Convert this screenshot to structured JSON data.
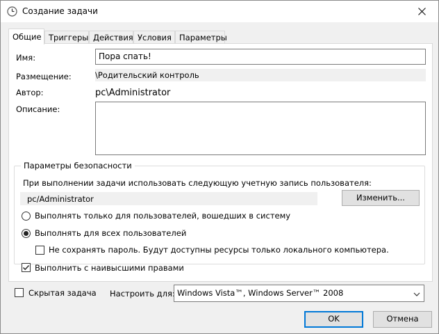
{
  "window": {
    "title": "Создание задачи"
  },
  "tabs": [
    {
      "label": "Общие"
    },
    {
      "label": "Триггеры"
    },
    {
      "label": "Действия"
    },
    {
      "label": "Условия"
    },
    {
      "label": "Параметры"
    }
  ],
  "general": {
    "name_label": "Имя:",
    "name_value": "Пора спать!",
    "location_label": "Размещение:",
    "location_value": "\\Родительский контроль",
    "author_label": "Автор:",
    "author_value": "pc\\Administrator",
    "description_label": "Описание:",
    "description_value": ""
  },
  "security": {
    "group_title": "Параметры безопасности",
    "account_prompt": "При выполнении задачи использовать следующую учетную запись пользователя:",
    "account_value": "pc/Administrator",
    "change_button": "Изменить...",
    "radio_logged_on": "Выполнять только для пользователей, вошедших в систему",
    "radio_all_users": "Выполнять для всех пользователей",
    "selected_radio": "all_users",
    "no_store_password": "Не сохранять пароль. Будут доступны ресурсы только локального компьютера.",
    "no_store_password_checked": false,
    "highest_privileges": "Выполнить с наивысшими правами",
    "highest_privileges_checked": true
  },
  "footer": {
    "hidden_label": "Скрытая задача",
    "hidden_checked": false,
    "configure_label": "Настроить для:",
    "configure_value": "Windows Vista™, Windows Server™ 2008",
    "ok_button": "OK",
    "cancel_button": "Отмена"
  }
}
